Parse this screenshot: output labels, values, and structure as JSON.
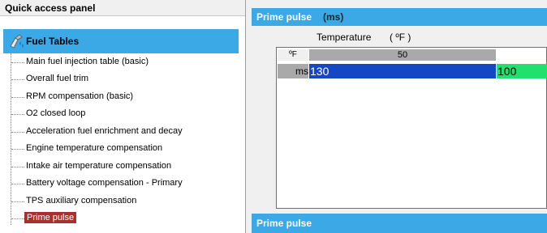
{
  "left_panel": {
    "title": "Quick access panel",
    "root": {
      "label": "Fuel Tables",
      "icon": "fuel-nozzle-icon"
    },
    "items": [
      {
        "label": "Main fuel injection table (basic)",
        "selected": false
      },
      {
        "label": "Overall fuel trim",
        "selected": false
      },
      {
        "label": "RPM compensation (basic)",
        "selected": false
      },
      {
        "label": "O2 closed loop",
        "selected": false
      },
      {
        "label": "Acceleration fuel enrichment and decay",
        "selected": false
      },
      {
        "label": "Engine temperature compensation",
        "selected": false
      },
      {
        "label": "Intake air temperature compensation",
        "selected": false
      },
      {
        "label": "Battery voltage compensation - Primary",
        "selected": false
      },
      {
        "label": "TPS auxiliary compensation",
        "selected": false
      },
      {
        "label": "Prime pulse",
        "selected": true
      }
    ]
  },
  "right_panel": {
    "title": "Prime pulse",
    "unit": "(ms)",
    "axis_label": "Temperature",
    "axis_unit": "( ºF )",
    "table": {
      "corner": "ºF",
      "column_headers": [
        "50"
      ],
      "row_header": "ms",
      "values": [
        "130",
        "100"
      ]
    },
    "bottom_title": "Prime pulse"
  },
  "colors": {
    "header_blue": "#3aa9e6",
    "selected_item": "#a7312d",
    "cell_blue": "#1546c4",
    "cell_green": "#22e06e"
  }
}
